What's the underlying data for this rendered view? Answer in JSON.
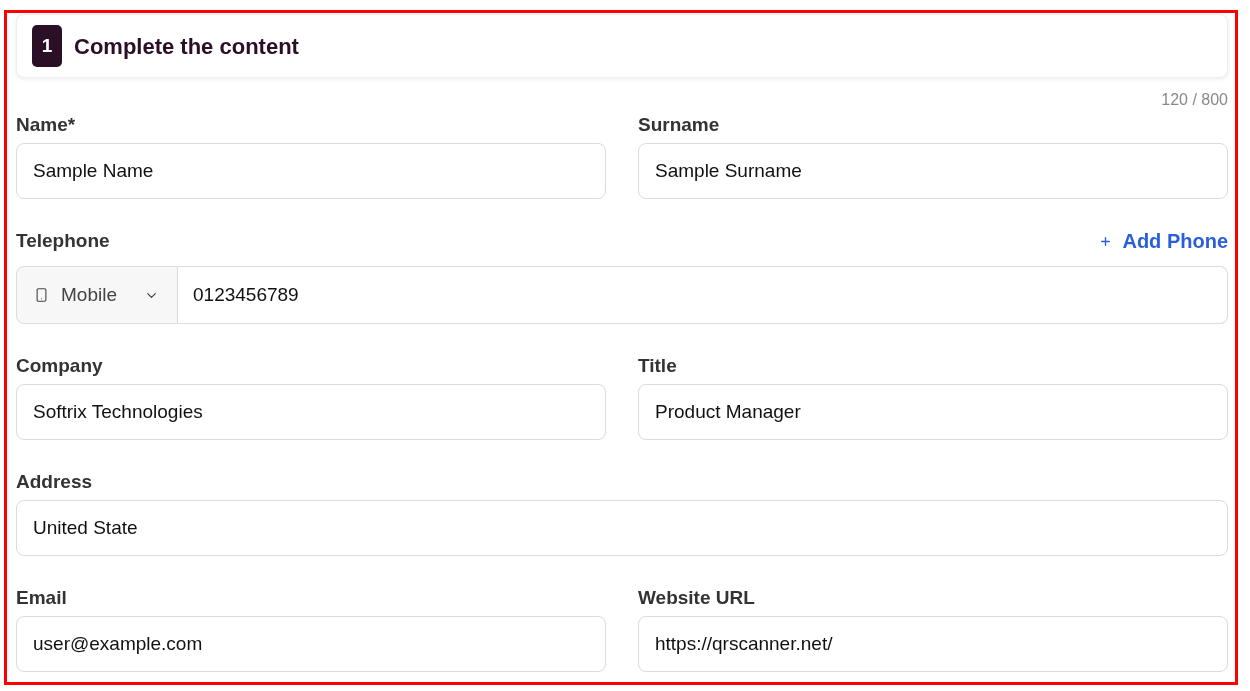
{
  "header": {
    "step": "1",
    "title": "Complete the content"
  },
  "counter": "120 / 800",
  "rows": [
    {
      "kind": "pair",
      "fields": [
        {
          "label": "Name*",
          "value": "Sample Name"
        },
        {
          "label": "Surname",
          "value": "Sample Surname"
        }
      ]
    },
    {
      "kind": "phone",
      "label": "Telephone",
      "action": "Add Phone",
      "phone_type": "Mobile",
      "value": "0123456789"
    },
    {
      "kind": "pair",
      "fields": [
        {
          "label": "Company",
          "value": "Softrix Technologies"
        },
        {
          "label": "Title",
          "value": "Product Manager"
        }
      ]
    },
    {
      "kind": "single",
      "fields": [
        {
          "label": "Address",
          "value": "United State"
        }
      ]
    },
    {
      "kind": "pair",
      "fields": [
        {
          "label": "Email",
          "value": "user@example.com"
        },
        {
          "label": "Website URL",
          "value": "https://qrscanner.net/"
        }
      ]
    }
  ]
}
